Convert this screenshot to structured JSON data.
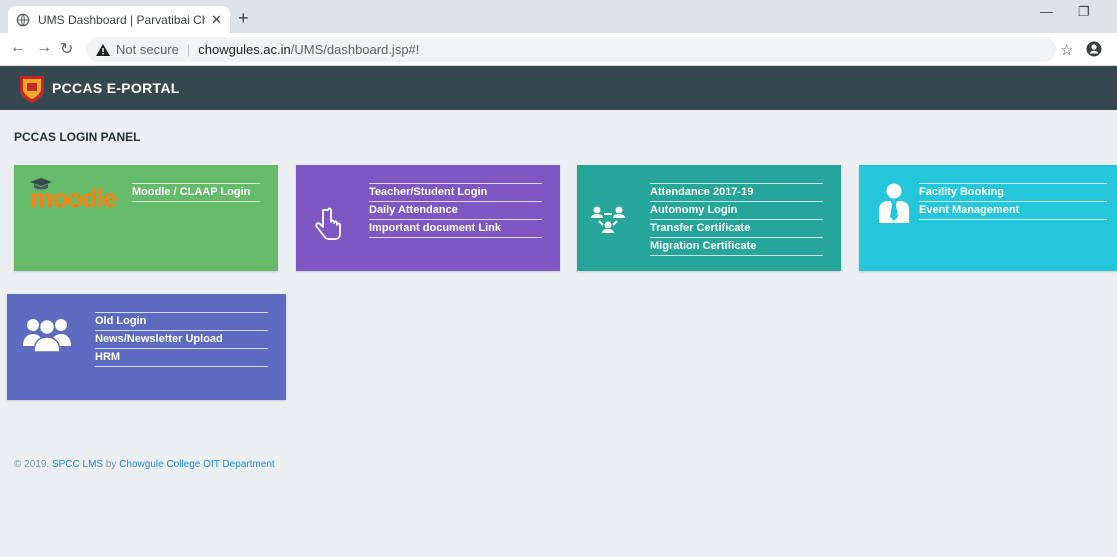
{
  "browser": {
    "tab_title": "UMS Dashboard | Parvatibai Chowgule",
    "new_tab": "+",
    "close_tab": "✕",
    "security_label": "Not secure",
    "url_host": "chowgules.ac.in",
    "url_path": "/UMS/dashboard.jsp#!"
  },
  "app": {
    "brand": "PCCAS E-PORTAL",
    "panel_title": "PCCAS LOGIN PANEL"
  },
  "cards": {
    "moodle": {
      "logo_text": "moodle",
      "links": [
        "Moodle / CLAAP Login"
      ],
      "color": "#66bb6a"
    },
    "teacher": {
      "links": [
        "Teacher/Student Login",
        "Daily Attendance",
        "Important document Link"
      ],
      "color": "#7e57c2",
      "icon": "hand-pointer-icon"
    },
    "attendance": {
      "links": [
        "Attendance 2017-19",
        "Autonomy Login",
        "Transfer Certificate",
        "Migration Certificate"
      ],
      "color": "#26a69a",
      "icon": "network-users-icon"
    },
    "facility": {
      "links": [
        "Facility Booking",
        "Event Management"
      ],
      "color": "#26c6da",
      "icon": "person-tie-icon"
    },
    "old": {
      "links": [
        "Old Login",
        "News/Newsletter Upload",
        "HRM"
      ],
      "color": "#5c6bc0",
      "icon": "group-users-icon"
    }
  },
  "footer": {
    "prefix": "© 2019.",
    "lms_link": "SPCC LMS",
    "by": "by",
    "dept_link": "Chowgule College OIT Department"
  }
}
